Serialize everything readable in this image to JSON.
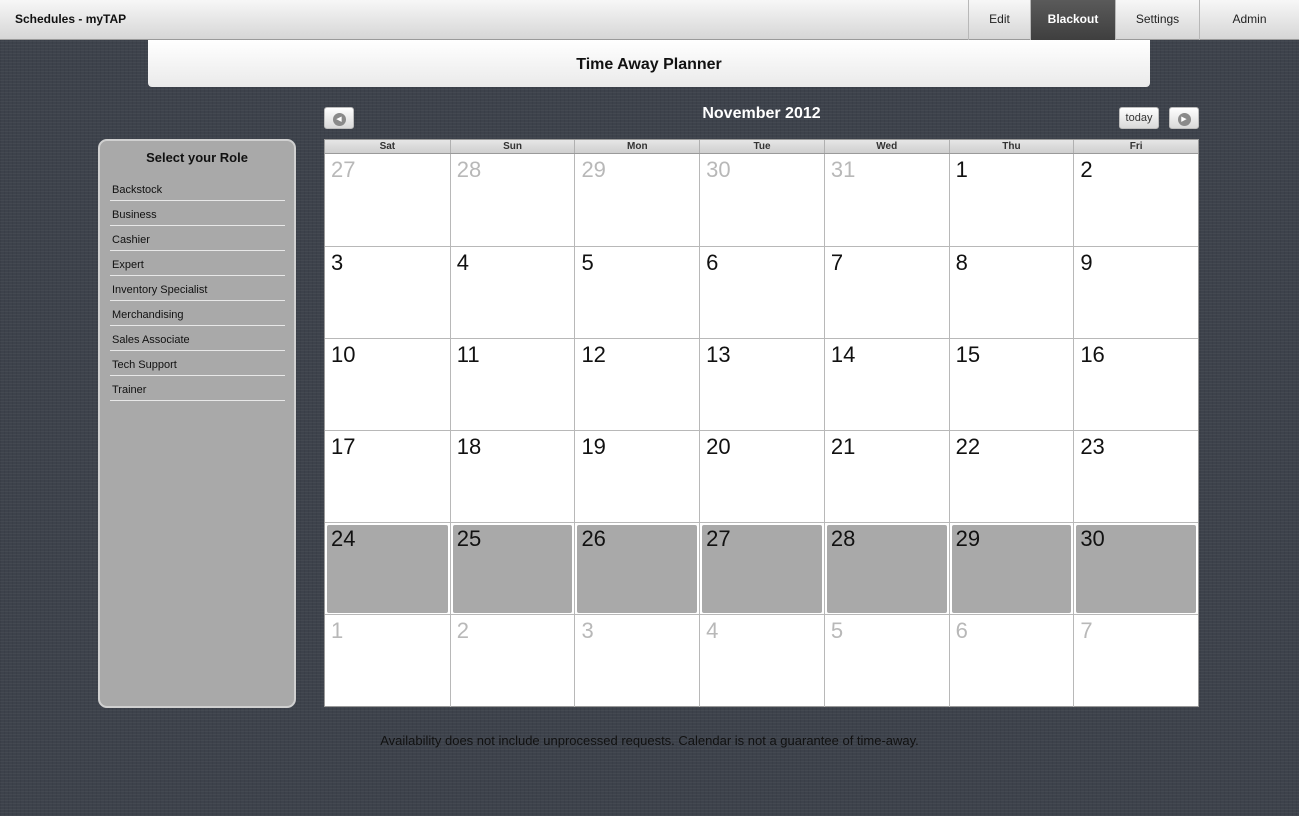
{
  "app": {
    "title": "Schedules - myTAP"
  },
  "nav": [
    {
      "label": "Edit",
      "active": false
    },
    {
      "label": "Blackout",
      "active": true
    },
    {
      "label": "Settings",
      "active": false
    },
    {
      "label": "Admin",
      "active": false
    }
  ],
  "header": {
    "title": "Time Away Planner"
  },
  "sidebar": {
    "title": "Select your Role",
    "roles": [
      "Backstock",
      "Business",
      "Cashier",
      "Expert",
      "Inventory Specialist",
      "Merchandising",
      "Sales Associate",
      "Tech Support",
      "Trainer"
    ]
  },
  "calendar": {
    "month_label": "November 2012",
    "today_label": "today",
    "prev_icon": "chevron-left-icon",
    "next_icon": "chevron-right-icon",
    "days_of_week": [
      "Sat",
      "Sun",
      "Mon",
      "Tue",
      "Wed",
      "Thu",
      "Fri"
    ],
    "weeks": [
      [
        {
          "d": "27",
          "other": true
        },
        {
          "d": "28",
          "other": true
        },
        {
          "d": "29",
          "other": true
        },
        {
          "d": "30",
          "other": true
        },
        {
          "d": "31",
          "other": true
        },
        {
          "d": "1"
        },
        {
          "d": "2"
        }
      ],
      [
        {
          "d": "3"
        },
        {
          "d": "4"
        },
        {
          "d": "5"
        },
        {
          "d": "6"
        },
        {
          "d": "7"
        },
        {
          "d": "8"
        },
        {
          "d": "9"
        }
      ],
      [
        {
          "d": "10"
        },
        {
          "d": "11"
        },
        {
          "d": "12"
        },
        {
          "d": "13"
        },
        {
          "d": "14"
        },
        {
          "d": "15"
        },
        {
          "d": "16"
        }
      ],
      [
        {
          "d": "17"
        },
        {
          "d": "18"
        },
        {
          "d": "19"
        },
        {
          "d": "20"
        },
        {
          "d": "21"
        },
        {
          "d": "22"
        },
        {
          "d": "23"
        }
      ],
      [
        {
          "d": "24",
          "blackout": true
        },
        {
          "d": "25",
          "blackout": true
        },
        {
          "d": "26",
          "blackout": true
        },
        {
          "d": "27",
          "blackout": true
        },
        {
          "d": "28",
          "blackout": true
        },
        {
          "d": "29",
          "blackout": true
        },
        {
          "d": "30",
          "blackout": true
        }
      ],
      [
        {
          "d": "1",
          "other": true
        },
        {
          "d": "2",
          "other": true
        },
        {
          "d": "3",
          "other": true
        },
        {
          "d": "4",
          "other": true
        },
        {
          "d": "5",
          "other": true
        },
        {
          "d": "6",
          "other": true
        },
        {
          "d": "7",
          "other": true
        }
      ]
    ]
  },
  "footer": {
    "disclaimer": "Availability does not include unprocessed requests. Calendar is not a guarantee of time-away."
  },
  "colors": {
    "background": "#3d424b",
    "blackout": "#a9a9a9",
    "nav_active": "#4a4a4a"
  }
}
